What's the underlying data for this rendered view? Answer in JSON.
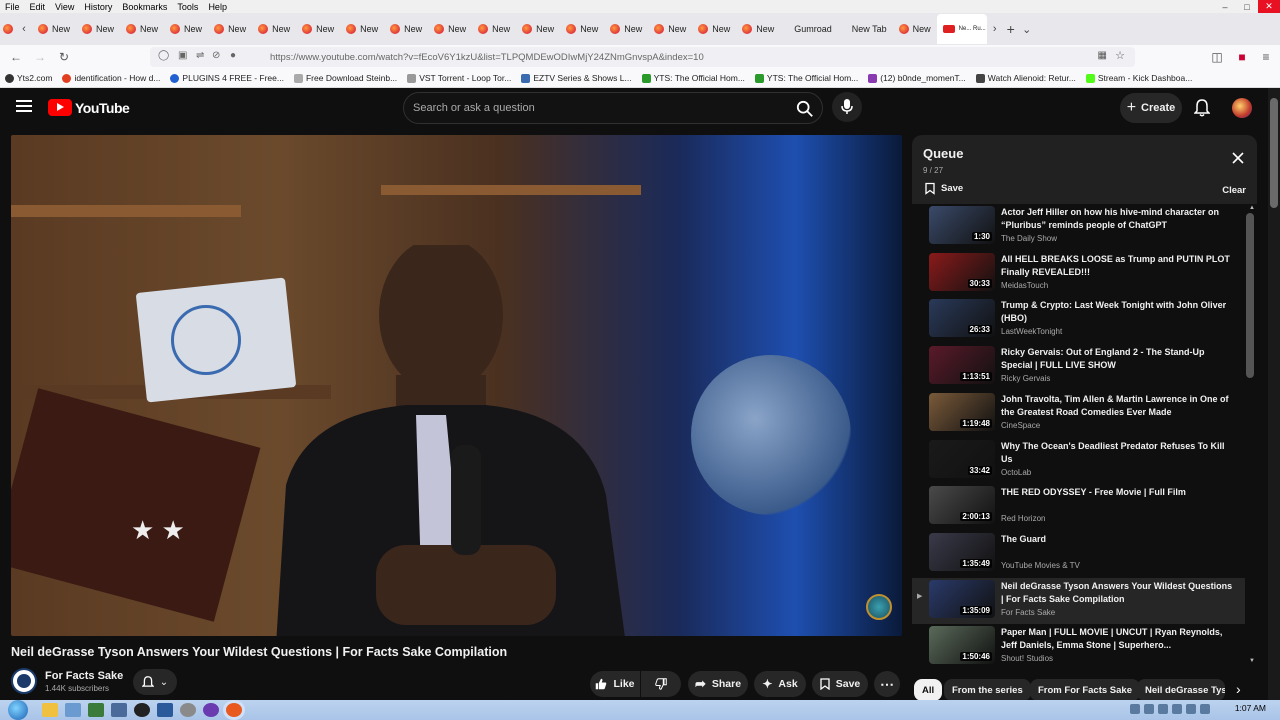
{
  "menubar": {
    "items": [
      "File",
      "Edit",
      "View",
      "History",
      "Bookmarks",
      "Tools",
      "Help"
    ]
  },
  "tabs": {
    "new_label": "New",
    "other": [
      "Gumroad",
      "New Tab"
    ],
    "active_label": "Ne... Ru..."
  },
  "nav": {
    "url": "https://www.youtube.com/watch?v=fEcoV6Y1kzU&list=TLPQMDEwODIwMjY24ZNmGnvspA&index=10"
  },
  "bookmarks": [
    "Yts2.com",
    "identification - How d...",
    "PLUGINS 4 FREE - Free...",
    "Free Download Steinb...",
    "VST Torrent - Loop Tor...",
    "EZTV Series & Shows L...",
    "YTS: The Official Hom...",
    "YTS: The Official Hom...",
    "(12) b0nde_momenT...",
    "Watch Alienoid: Retur...",
    "Stream - Kick Dashboa..."
  ],
  "header": {
    "logo": "YouTube",
    "search_placeholder": "Search or ask a question",
    "create_label": "Create"
  },
  "video": {
    "title": "Neil deGrasse Tyson Answers Your Wildest Questions | For Facts Sake Compilation",
    "channel": "For Facts Sake",
    "subscribers": "1.44K subscribers",
    "actions": {
      "like": "Like",
      "share": "Share",
      "ask": "Ask",
      "save": "Save"
    }
  },
  "queue": {
    "title": "Queue",
    "position": "9 / 27",
    "save": "Save",
    "clear": "Clear",
    "items": [
      {
        "title": "Actor Jeff Hiller on how his hive-mind character on “Pluribus” reminds people of ChatGPT",
        "channel": "The Daily Show",
        "duration": "1:30",
        "thumb": "#3a4a6a"
      },
      {
        "title": "All HELL BREAKS LOOSE as Trump and PUTIN PLOT Finally REVEALED!!!",
        "channel": "MeidasTouch",
        "duration": "30:33",
        "thumb": "#8a1a1a"
      },
      {
        "title": "Trump & Crypto: Last Week Tonight with John Oliver (HBO)",
        "channel": "LastWeekTonight",
        "duration": "26:33",
        "thumb": "#2a3a5a"
      },
      {
        "title": "Ricky Gervais: Out of England 2 - The Stand-Up Special | FULL LIVE SHOW",
        "channel": "Ricky Gervais",
        "duration": "1:13:51",
        "thumb": "#5a1a2a"
      },
      {
        "title": "John Travolta, Tim Allen & Martin Lawrence in One of the Greatest Road Comedies Ever Made",
        "channel": "CineSpace",
        "duration": "1:19:48",
        "thumb": "#7a5a3a"
      },
      {
        "title": "Why The Ocean's Deadliest Predator Refuses To Kill Us",
        "channel": "OctoLab",
        "duration": "33:42",
        "thumb": "#1a1a1a"
      },
      {
        "title": "THE RED ODYSSEY - Free Movie | Full Film",
        "channel": "Red Horizon",
        "duration": "2:00:13",
        "thumb": "#4a4a4a"
      },
      {
        "title": "The Guard",
        "channel": "YouTube Movies & TV",
        "duration": "1:35:49",
        "thumb": "#3a3a4a"
      },
      {
        "title": "Neil deGrasse Tyson Answers Your Wildest Questions | For Facts Sake Compilation",
        "channel": "For Facts Sake",
        "duration": "1:35:09",
        "thumb": "#2a3a6a",
        "current": true
      },
      {
        "title": "Paper Man | FULL MOVIE | UNCUT | Ryan Reynolds, Jeff Daniels, Emma Stone | Superhero...",
        "channel": "Shout! Studios",
        "duration": "1:50:46",
        "thumb": "#5a6a5a"
      }
    ]
  },
  "chips": [
    "All",
    "From the series",
    "From For Facts Sake",
    "Neil deGrasse Tys"
  ],
  "taskbar": {
    "clock": "1:07 AM"
  }
}
